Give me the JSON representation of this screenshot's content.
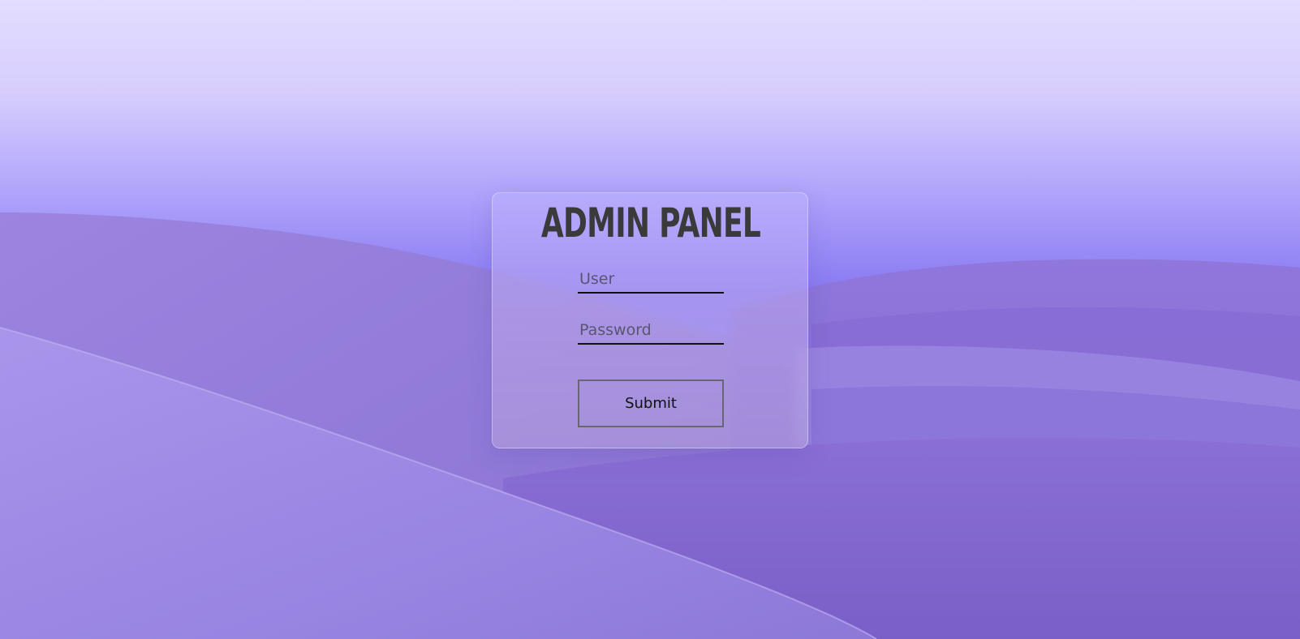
{
  "login_panel": {
    "title": "ADMIN PANEL",
    "user_field": {
      "placeholder": "User",
      "value": ""
    },
    "password_field": {
      "placeholder": "Password",
      "value": ""
    },
    "submit_label": "Submit"
  },
  "colors": {
    "sky_top": "#e2dcff",
    "sky_horizon": "#8c7cf4",
    "dunes": "#9a86e0",
    "title_text": "#3a3a3a"
  }
}
